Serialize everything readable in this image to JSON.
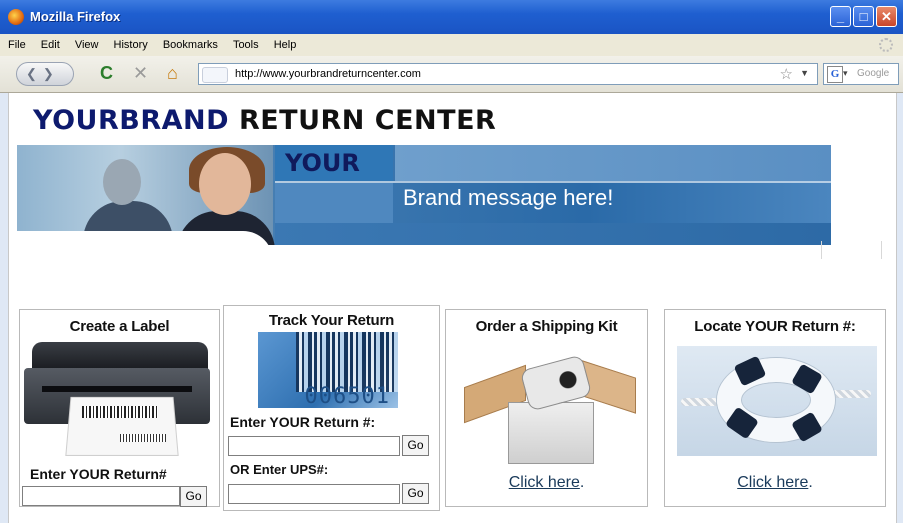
{
  "window": {
    "title": "Mozilla Firefox"
  },
  "menu": [
    "File",
    "Edit",
    "View",
    "History",
    "Bookmarks",
    "Tools",
    "Help"
  ],
  "nav": {
    "url": "http://www.yourbrandreturncenter.com",
    "search_placeholder": "Google"
  },
  "header": {
    "brand_part1": "YOURBRAND",
    "brand_part2": "RETURN CENTER"
  },
  "banner": {
    "your": "YOUR",
    "message": "Brand message here!"
  },
  "panels": {
    "create": {
      "title": "Create a Label",
      "label": "Enter YOUR Return#",
      "go": "Go"
    },
    "track": {
      "title": "Track Your Return",
      "barcode_number": "006501",
      "label1": "Enter YOUR Return #:",
      "go1": "Go",
      "label2": "OR Enter UPS#:",
      "go2": "Go"
    },
    "order": {
      "title": "Order a Shipping Kit",
      "link": "Click here",
      "after": "."
    },
    "locate": {
      "title": "Locate YOUR Return #:",
      "link": "Click here",
      "after": "."
    }
  },
  "colors": {
    "brand_navy": "#0d1a6e",
    "banner_blue": "#2f77b6",
    "titlebar": "#1f5fd0"
  }
}
